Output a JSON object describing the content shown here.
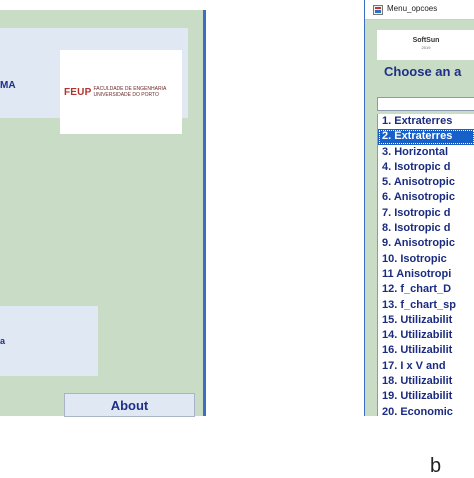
{
  "left_window": {
    "header_fragment": "MA",
    "logo_mark": "FEUP",
    "logo_line1": "FACULDADE DE ENGENHARIA",
    "logo_line2": "UNIVERSIDADE DO PORTO",
    "panel_fragment": "a",
    "about_label": "About"
  },
  "right_window": {
    "title": "Menu_opcoes",
    "logo_name": "SoftSun",
    "logo_year": "2019",
    "prompt": "Choose an a",
    "list_items": [
      "1. Extraterres",
      "2. Extraterres",
      "3. Horizontal",
      "4. Isotropic d",
      "5. Anisotropic",
      "6. Anisotropic",
      "7. Isotropic d",
      "8. Isotropic d",
      "9. Anisotropic",
      "10. Isotropic",
      "11 Anisotropi",
      "12. f_chart_D",
      "13. f_chart_sp",
      "15. Utilizabilit",
      "14. Utilizabilit",
      "16. Utilizabilit",
      "17. I x V and",
      "18. Utilizabilit",
      "19. Utilizabilit",
      "20. Economic"
    ],
    "selected_index": 1
  },
  "caption_fragment": "b",
  "colors": {
    "window_bg": "#c9dcc5",
    "panel_bg": "#dfe8f3",
    "text_blue": "#1f2f88",
    "selection": "#1860c9"
  }
}
